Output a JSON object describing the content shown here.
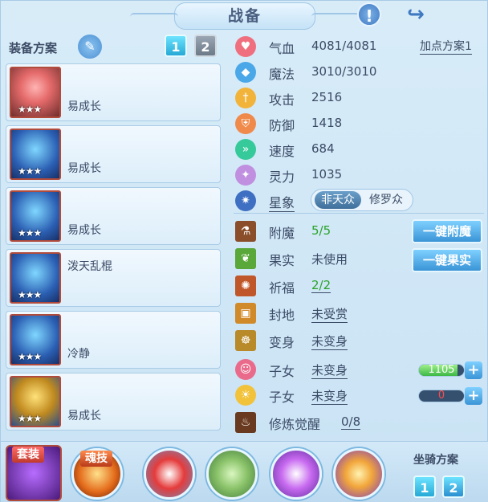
{
  "title": "战备",
  "header": {
    "warn_icon": "!",
    "share_icon": "↪"
  },
  "equip_plan": {
    "label": "装备方案",
    "tabs": [
      "1",
      "2"
    ],
    "active_tab": "1"
  },
  "equipment": [
    {
      "name": "易成长",
      "stars": "★★★",
      "icon": "popsicle-weapon-icon"
    },
    {
      "name": "易成长",
      "stars": "★★★",
      "icon": "blue-helmet-icon"
    },
    {
      "name": "易成长",
      "stars": "★★★",
      "icon": "blue-armor-icon"
    },
    {
      "name": "泼天乱棍",
      "stars": "★★★",
      "icon": "blue-necklace-icon"
    },
    {
      "name": "冷静",
      "stars": "★★★",
      "icon": "blue-belt-icon"
    },
    {
      "name": "易成长",
      "stars": "★★★",
      "icon": "gold-boots-icon"
    }
  ],
  "stats": {
    "hp": {
      "label": "气血",
      "value": "4081/4081"
    },
    "mp": {
      "label": "魔法",
      "value": "3010/3010"
    },
    "atk": {
      "label": "攻击",
      "value": "2516"
    },
    "def": {
      "label": "防御",
      "value": "1418"
    },
    "spd": {
      "label": "速度",
      "value": "684"
    },
    "spirit": {
      "label": "灵力",
      "value": "1035"
    },
    "star": {
      "label": "星象",
      "option_a": "非天众",
      "option_b": "修罗众"
    },
    "point_plan": "加点方案1"
  },
  "extras": {
    "enchant": {
      "label": "附魔",
      "value": "5/5",
      "button": "一键附魔"
    },
    "fruit": {
      "label": "果实",
      "value": "未使用",
      "button": "一键果实"
    },
    "blessing": {
      "label": "祈福",
      "value": "2/2"
    },
    "land": {
      "label": "封地",
      "value": "未受赏"
    },
    "transform": {
      "label": "变身",
      "value": "未变身"
    },
    "child1": {
      "label": "子女",
      "value": "未变身",
      "bar_value": "1105",
      "bar_fill": 0.85
    },
    "child2": {
      "label": "子女",
      "value": "未变身",
      "bar_value": "0",
      "bar_fill": 0
    },
    "cultivation": {
      "label": "修炼觉醒",
      "value": "0/8"
    }
  },
  "bottom": {
    "set_label": "套装",
    "soul_label": "魂技",
    "mount_plan_label": "坐骑方案",
    "mount_tabs": [
      "1",
      "2"
    ]
  },
  "colors": {
    "accent": "#3a94d6",
    "green_text": "#2aa32a",
    "frame_bg": "#cfe7f7"
  }
}
